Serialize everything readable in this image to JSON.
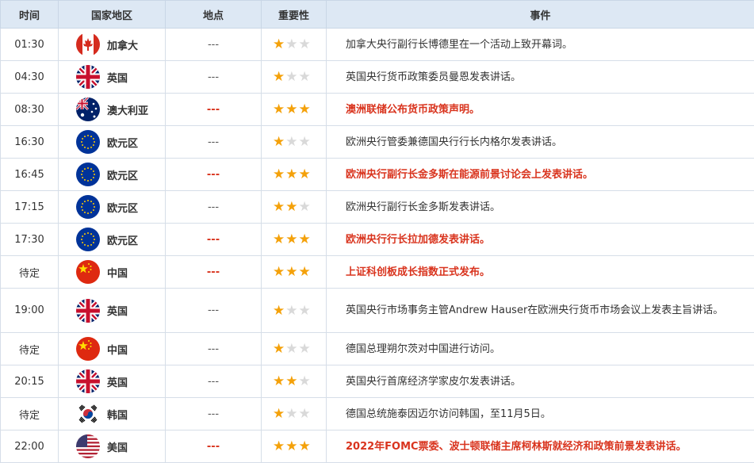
{
  "headers": {
    "time": "时间",
    "country": "国家地区",
    "location": "地点",
    "importance": "重要性",
    "event": "事件"
  },
  "rows": [
    {
      "time": "01:30",
      "flag": "canada-flag",
      "country": "加拿大",
      "location": "---",
      "stars": 1,
      "event": "加拿大央行副行长博德里在一个活动上致开幕词。",
      "highlight": false
    },
    {
      "time": "04:30",
      "flag": "uk-flag",
      "country": "英国",
      "location": "---",
      "stars": 1,
      "event": "英国央行货币政策委员曼恩发表讲话。",
      "highlight": false
    },
    {
      "time": "08:30",
      "flag": "australia-flag",
      "country": "澳大利亚",
      "location": "---",
      "stars": 3,
      "event": "澳洲联储公布货币政策声明。",
      "highlight": true
    },
    {
      "time": "16:30",
      "flag": "eu-flag",
      "country": "欧元区",
      "location": "---",
      "stars": 1,
      "event": "欧洲央行管委兼德国央行行长内格尔发表讲话。",
      "highlight": false
    },
    {
      "time": "16:45",
      "flag": "eu-flag",
      "country": "欧元区",
      "location": "---",
      "stars": 3,
      "event": "欧洲央行副行长金多斯在能源前景讨论会上发表讲话。",
      "highlight": true
    },
    {
      "time": "17:15",
      "flag": "eu-flag",
      "country": "欧元区",
      "location": "---",
      "stars": 2,
      "event": "欧洲央行副行长金多斯发表讲话。",
      "highlight": false
    },
    {
      "time": "17:30",
      "flag": "eu-flag",
      "country": "欧元区",
      "location": "---",
      "stars": 3,
      "event": "欧洲央行行长拉加德发表讲话。",
      "highlight": true
    },
    {
      "time": "待定",
      "flag": "china-flag",
      "country": "中国",
      "location": "---",
      "stars": 3,
      "event": "上证科创板成长指数正式发布。",
      "highlight": true
    },
    {
      "time": "19:00",
      "flag": "uk-flag",
      "country": "英国",
      "location": "---",
      "stars": 1,
      "event": "英国央行市场事务主管Andrew Hauser在欧洲央行货币市场会议上发表主旨讲话。",
      "highlight": false
    },
    {
      "time": "待定",
      "flag": "china-flag",
      "country": "中国",
      "location": "---",
      "stars": 1,
      "event": "德国总理朔尔茨对中国进行访问。",
      "highlight": false
    },
    {
      "time": "20:15",
      "flag": "uk-flag",
      "country": "英国",
      "location": "---",
      "stars": 2,
      "event": "英国央行首席经济学家皮尔发表讲话。",
      "highlight": false
    },
    {
      "time": "待定",
      "flag": "korea-flag",
      "country": "韩国",
      "location": "---",
      "stars": 1,
      "event": "德国总统施泰因迈尔访问韩国，至11月5日。",
      "highlight": false
    },
    {
      "time": "22:00",
      "flag": "usa-flag",
      "country": "美国",
      "location": "---",
      "stars": 3,
      "event": "2022年FOMC票委、波士顿联储主席柯林斯就经济和政策前景发表讲话。",
      "highlight": true
    }
  ],
  "colors": {
    "header_bg": "#dde8f4",
    "highlight": "#d9341e",
    "star_on": "#f4a10a",
    "star_off": "#d9d9d9"
  }
}
